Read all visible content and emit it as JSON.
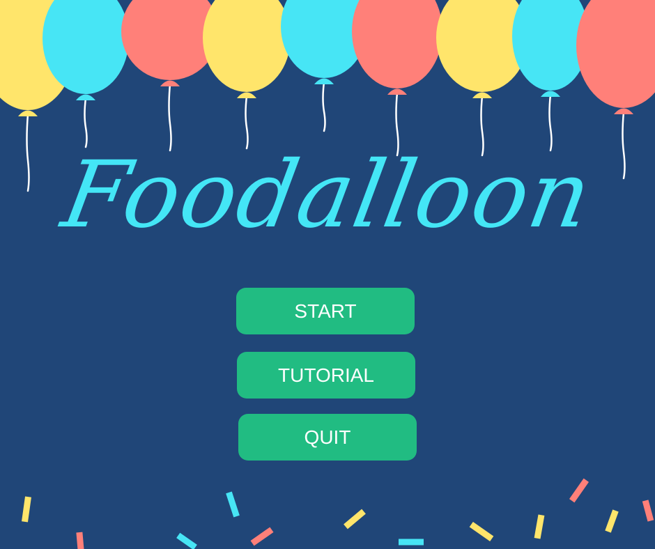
{
  "game": {
    "title": "Foodalloon"
  },
  "menu": {
    "start_label": "START",
    "tutorial_label": "TUTORIAL",
    "quit_label": "QUIT"
  },
  "colors": {
    "background": "#204678",
    "title": "#44E6F6",
    "button": "#21BC82",
    "button_text": "#FFFFFF",
    "balloon_yellow": "#FFE56B",
    "balloon_cyan": "#47E5F5",
    "balloon_coral": "#FF8079",
    "string": "#FFFFFF"
  },
  "balloons": [
    {
      "color": "balloon_yellow",
      "icon": "balloon-icon"
    },
    {
      "color": "balloon_cyan",
      "icon": "balloon-icon"
    },
    {
      "color": "balloon_coral",
      "icon": "balloon-icon"
    },
    {
      "color": "balloon_yellow",
      "icon": "balloon-icon"
    },
    {
      "color": "balloon_cyan",
      "icon": "balloon-icon"
    },
    {
      "color": "balloon_coral",
      "icon": "balloon-icon"
    },
    {
      "color": "balloon_yellow",
      "icon": "balloon-icon"
    },
    {
      "color": "balloon_cyan",
      "icon": "balloon-icon"
    },
    {
      "color": "balloon_coral",
      "icon": "balloon-icon"
    }
  ],
  "confetti": [
    {
      "color": "balloon_yellow"
    },
    {
      "color": "balloon_coral"
    },
    {
      "color": "balloon_cyan"
    },
    {
      "color": "balloon_cyan"
    },
    {
      "color": "balloon_coral"
    },
    {
      "color": "balloon_yellow"
    },
    {
      "color": "balloon_cyan"
    },
    {
      "color": "balloon_yellow"
    },
    {
      "color": "balloon_yellow"
    },
    {
      "color": "balloon_coral"
    },
    {
      "color": "balloon_yellow"
    },
    {
      "color": "balloon_coral"
    }
  ]
}
